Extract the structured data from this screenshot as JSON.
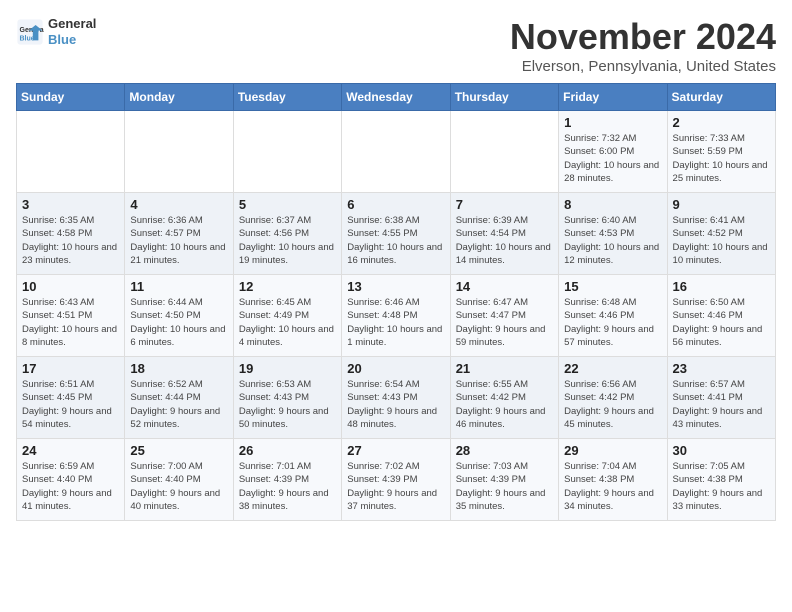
{
  "logo": {
    "line1": "General",
    "line2": "Blue"
  },
  "title": "November 2024",
  "location": "Elverson, Pennsylvania, United States",
  "days_of_week": [
    "Sunday",
    "Monday",
    "Tuesday",
    "Wednesday",
    "Thursday",
    "Friday",
    "Saturday"
  ],
  "weeks": [
    [
      {
        "day": "",
        "info": ""
      },
      {
        "day": "",
        "info": ""
      },
      {
        "day": "",
        "info": ""
      },
      {
        "day": "",
        "info": ""
      },
      {
        "day": "",
        "info": ""
      },
      {
        "day": "1",
        "info": "Sunrise: 7:32 AM\nSunset: 6:00 PM\nDaylight: 10 hours and 28 minutes."
      },
      {
        "day": "2",
        "info": "Sunrise: 7:33 AM\nSunset: 5:59 PM\nDaylight: 10 hours and 25 minutes."
      }
    ],
    [
      {
        "day": "3",
        "info": "Sunrise: 6:35 AM\nSunset: 4:58 PM\nDaylight: 10 hours and 23 minutes."
      },
      {
        "day": "4",
        "info": "Sunrise: 6:36 AM\nSunset: 4:57 PM\nDaylight: 10 hours and 21 minutes."
      },
      {
        "day": "5",
        "info": "Sunrise: 6:37 AM\nSunset: 4:56 PM\nDaylight: 10 hours and 19 minutes."
      },
      {
        "day": "6",
        "info": "Sunrise: 6:38 AM\nSunset: 4:55 PM\nDaylight: 10 hours and 16 minutes."
      },
      {
        "day": "7",
        "info": "Sunrise: 6:39 AM\nSunset: 4:54 PM\nDaylight: 10 hours and 14 minutes."
      },
      {
        "day": "8",
        "info": "Sunrise: 6:40 AM\nSunset: 4:53 PM\nDaylight: 10 hours and 12 minutes."
      },
      {
        "day": "9",
        "info": "Sunrise: 6:41 AM\nSunset: 4:52 PM\nDaylight: 10 hours and 10 minutes."
      }
    ],
    [
      {
        "day": "10",
        "info": "Sunrise: 6:43 AM\nSunset: 4:51 PM\nDaylight: 10 hours and 8 minutes."
      },
      {
        "day": "11",
        "info": "Sunrise: 6:44 AM\nSunset: 4:50 PM\nDaylight: 10 hours and 6 minutes."
      },
      {
        "day": "12",
        "info": "Sunrise: 6:45 AM\nSunset: 4:49 PM\nDaylight: 10 hours and 4 minutes."
      },
      {
        "day": "13",
        "info": "Sunrise: 6:46 AM\nSunset: 4:48 PM\nDaylight: 10 hours and 1 minute."
      },
      {
        "day": "14",
        "info": "Sunrise: 6:47 AM\nSunset: 4:47 PM\nDaylight: 9 hours and 59 minutes."
      },
      {
        "day": "15",
        "info": "Sunrise: 6:48 AM\nSunset: 4:46 PM\nDaylight: 9 hours and 57 minutes."
      },
      {
        "day": "16",
        "info": "Sunrise: 6:50 AM\nSunset: 4:46 PM\nDaylight: 9 hours and 56 minutes."
      }
    ],
    [
      {
        "day": "17",
        "info": "Sunrise: 6:51 AM\nSunset: 4:45 PM\nDaylight: 9 hours and 54 minutes."
      },
      {
        "day": "18",
        "info": "Sunrise: 6:52 AM\nSunset: 4:44 PM\nDaylight: 9 hours and 52 minutes."
      },
      {
        "day": "19",
        "info": "Sunrise: 6:53 AM\nSunset: 4:43 PM\nDaylight: 9 hours and 50 minutes."
      },
      {
        "day": "20",
        "info": "Sunrise: 6:54 AM\nSunset: 4:43 PM\nDaylight: 9 hours and 48 minutes."
      },
      {
        "day": "21",
        "info": "Sunrise: 6:55 AM\nSunset: 4:42 PM\nDaylight: 9 hours and 46 minutes."
      },
      {
        "day": "22",
        "info": "Sunrise: 6:56 AM\nSunset: 4:42 PM\nDaylight: 9 hours and 45 minutes."
      },
      {
        "day": "23",
        "info": "Sunrise: 6:57 AM\nSunset: 4:41 PM\nDaylight: 9 hours and 43 minutes."
      }
    ],
    [
      {
        "day": "24",
        "info": "Sunrise: 6:59 AM\nSunset: 4:40 PM\nDaylight: 9 hours and 41 minutes."
      },
      {
        "day": "25",
        "info": "Sunrise: 7:00 AM\nSunset: 4:40 PM\nDaylight: 9 hours and 40 minutes."
      },
      {
        "day": "26",
        "info": "Sunrise: 7:01 AM\nSunset: 4:39 PM\nDaylight: 9 hours and 38 minutes."
      },
      {
        "day": "27",
        "info": "Sunrise: 7:02 AM\nSunset: 4:39 PM\nDaylight: 9 hours and 37 minutes."
      },
      {
        "day": "28",
        "info": "Sunrise: 7:03 AM\nSunset: 4:39 PM\nDaylight: 9 hours and 35 minutes."
      },
      {
        "day": "29",
        "info": "Sunrise: 7:04 AM\nSunset: 4:38 PM\nDaylight: 9 hours and 34 minutes."
      },
      {
        "day": "30",
        "info": "Sunrise: 7:05 AM\nSunset: 4:38 PM\nDaylight: 9 hours and 33 minutes."
      }
    ]
  ]
}
